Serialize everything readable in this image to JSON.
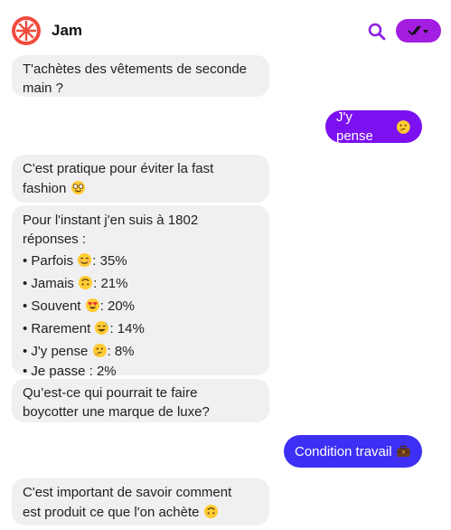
{
  "header": {
    "title": "Jam"
  },
  "messages": {
    "m1": {
      "line1": "T'achètes des vêtements de seconde",
      "line2": "main ?"
    },
    "m2": {
      "text": "J'y pense"
    },
    "m3": {
      "line1": "C'est pratique pour éviter la fast",
      "line2": "fashion"
    },
    "poll": {
      "head1": "Pour l'instant j'en suis à 1802",
      "head2": "réponses :",
      "items": [
        {
          "label": "• Parfois",
          "value": ": 35%"
        },
        {
          "label": "• Jamais",
          "value": ": 21%"
        },
        {
          "label": "• Souvent",
          "value": ": 20%"
        },
        {
          "label": "• Rarement",
          "value": ": 14%"
        },
        {
          "label": "• J'y pense",
          "value": ": 8%"
        },
        {
          "label": "• Je passe : 2%",
          "value": ""
        }
      ]
    },
    "m5": {
      "line1": "Qu’est-ce qui pourrait te faire",
      "line2": "boycotter une marque de luxe?"
    },
    "m6": {
      "text": "Condition travail"
    },
    "m7": {
      "line1": "C'est important de savoir comment",
      "line2": "est produit ce que l'on achète"
    }
  },
  "icons": {
    "logo": "jam-logo-icon",
    "search": "search-icon",
    "check": "double-check-icon",
    "emoji_thinking": "thinking-face-icon",
    "emoji_nerd": "nerd-face-icon",
    "emoji_smile": "smiling-face-icon",
    "emoji_upside": "upside-down-face-icon",
    "emoji_hearteyes": "heart-eyes-icon",
    "emoji_sweat": "grinning-sweat-icon",
    "emoji_briefcase": "briefcase-icon"
  },
  "colors": {
    "accent_purple": "#7b10f0",
    "accent_blue": "#3d2ff3",
    "header_button": "#a31ee0",
    "bot_bubble": "#f0f0f3",
    "logo_red": "#f24a3d"
  }
}
